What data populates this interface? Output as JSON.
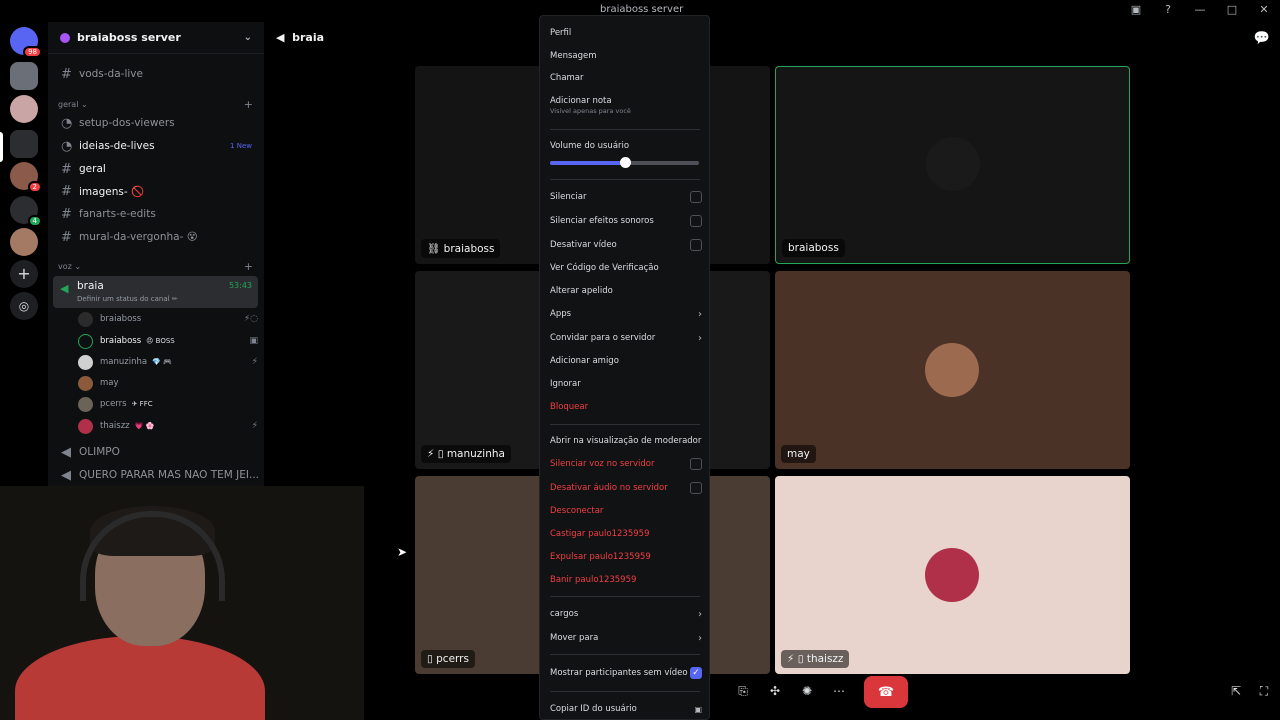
{
  "window": {
    "title": "braiaboss server"
  },
  "guilds": {
    "badge_top": "98",
    "badge_mid": "2",
    "badge_green": "4"
  },
  "sidebar": {
    "server_name": "braiaboss server",
    "channels": {
      "vods": "vods-da-live",
      "setup": "setup-dos-viewers",
      "ideias": "ideias-de-lives",
      "ideias_new": "1 New",
      "geral": "geral",
      "imagens": "imagens- 🚫",
      "fanarts": "fanarts-e-edits",
      "mural": "mural-da-vergonha- 😵"
    },
    "categories": {
      "geral": "geral ⌄",
      "voz": "voz ⌄"
    },
    "voice": {
      "name": "braia",
      "status": "Definir um status do canal ✏",
      "time": "53:43"
    },
    "voice_users": [
      {
        "name": "braiaboss",
        "tag": ""
      },
      {
        "name": "braiaboss",
        "tag": "😠 BOSS"
      },
      {
        "name": "manuzinha",
        "tag": "💎 🎮"
      },
      {
        "name": "may",
        "tag": ""
      },
      {
        "name": "pcerrs",
        "tag": "✈ FFC"
      },
      {
        "name": "thaiszz",
        "tag": "💗 🌸"
      }
    ],
    "olimpo": "OLIMPO",
    "quero": "QUERO PARAR MAS NAO TEM JEI..."
  },
  "main": {
    "channel": "braia",
    "tiles": {
      "t1": "braiaboss",
      "t2": "braiaboss",
      "t3": "manuzinha",
      "t4": "may",
      "t5": "pcerrs",
      "t6": "thaiszz"
    }
  },
  "menu": {
    "perfil": "Perfil",
    "mensagem": "Mensagem",
    "chamar": "Chamar",
    "nota": "Adicionar nota",
    "nota_sub": "Visível apenas para você",
    "volume": "Volume do usuário",
    "volume_value": 0.5,
    "silenciar": "Silenciar",
    "silenciar_efeitos": "Silenciar efeitos sonoros",
    "desativar_video": "Desativar vídeo",
    "codigo": "Ver Código de Verificação",
    "apelido": "Alterar apelido",
    "apps": "Apps",
    "convidar": "Convidar para o servidor",
    "amigo": "Adicionar amigo",
    "ignorar": "Ignorar",
    "bloquear": "Bloquear",
    "moderador": "Abrir na visualização de moderador",
    "silenciar_voz": "Silenciar voz no servidor",
    "desativar_audio": "Desativar áudio no servidor",
    "desconectar": "Desconectar",
    "castigar": "Castigar paulo1235959",
    "expulsar": "Expulsar paulo1235959",
    "banir": "Banir paulo1235959",
    "cargos": "cargos",
    "mover": "Mover para",
    "mostrar": "Mostrar participantes sem vídeo",
    "copiar": "Copiar ID do usuário"
  },
  "colors": {
    "accent": "#5865f2",
    "danger": "#f23f43",
    "online": "#23a55a"
  }
}
